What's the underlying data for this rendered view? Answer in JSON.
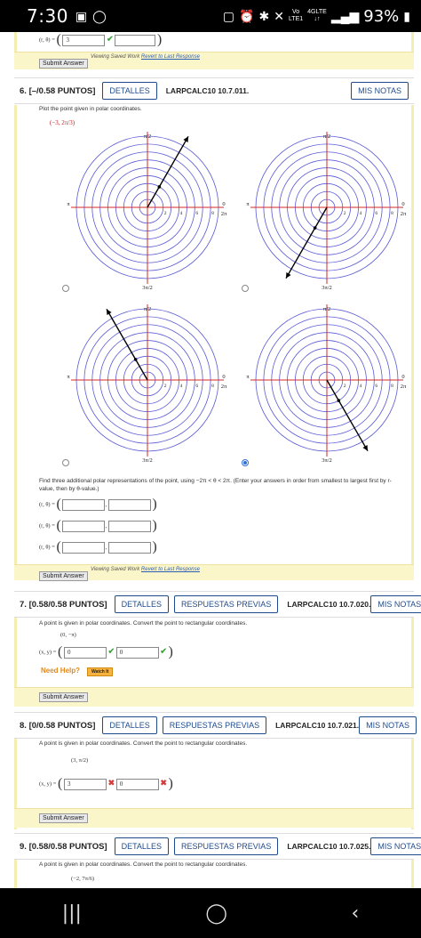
{
  "status": {
    "time": "7:30",
    "network_top": "4GLTE",
    "network_vo": "Vo",
    "network_lte": "LTE1",
    "battery": "93%"
  },
  "prev_answer": {
    "label": "(r, θ) =",
    "value": "3"
  },
  "common": {
    "submit_label": "Submit Answer",
    "viewing_text": "Viewing Saved Work",
    "revert_text": "Revert to Last Response",
    "detalles": "DETALLES",
    "respuestas": "RESPUESTAS PREVIAS",
    "notes": "MIS NOTAS",
    "need_help": "Need Help?",
    "watch_it": "Watch It"
  },
  "q6": {
    "num": "6.",
    "score": "[–/0.58 PUNTOS]",
    "code": "LARPCALC10 10.7.011.",
    "prompt": "Plot the point given in polar coordinates.",
    "point": "(−3, 2π/3)",
    "axis_labels": {
      "top": "π/2",
      "left": "π",
      "right": "0",
      "right_2pi": "2π",
      "bottom": "3π/2"
    },
    "radial_ticks": [
      "2",
      "4",
      "6",
      "8"
    ],
    "instructions": "Find three additional polar representations of the point, using −2π < θ < 2π. (Enter your answers in order from smallest to largest first by r-value, then by θ-value.)",
    "rows": [
      "(r, θ) =",
      "(r, θ) =",
      "(r, θ) ="
    ],
    "selected_option": 4
  },
  "q7": {
    "num": "7.",
    "score": "[0.58/0.58 PUNTOS]",
    "code": "LARPCALC10 10.7.020.",
    "prompt": "A point is given in polar coordinates. Convert the point to rectangular coordinates.",
    "point": "(0, −π)",
    "label": "(x, y) =",
    "x": "0",
    "y": "0"
  },
  "q8": {
    "num": "8.",
    "score": "[0/0.58 PUNTOS]",
    "code": "LARPCALC10 10.7.021.",
    "prompt": "A point is given in polar coordinates. Convert the point to rectangular coordinates.",
    "point": "(3, π/2)",
    "label": "(x, y) =",
    "x": "3",
    "y": "0"
  },
  "q9": {
    "num": "9.",
    "score": "[0.58/0.58 PUNTOS]",
    "code": "LARPCALC10 10.7.025.",
    "prompt": "A point is given in polar coordinates. Convert the point to rectangular coordinates.",
    "point": "(−2, 7π/6)"
  },
  "colors": {
    "circle": "#5a5ad6",
    "axis": "#d42a2a",
    "accent": "#1f4b8e",
    "frame_yellow": "#f3efb0"
  }
}
